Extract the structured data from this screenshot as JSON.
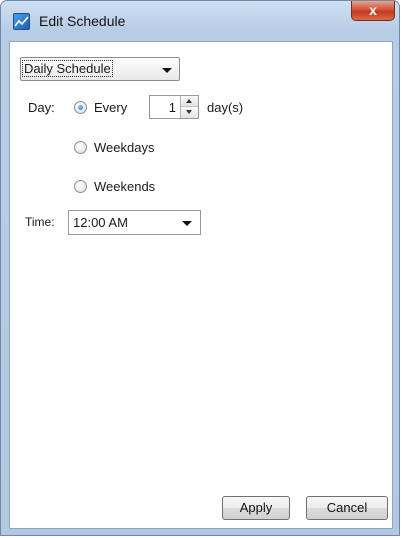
{
  "window": {
    "title": "Edit Schedule",
    "close_label": "x"
  },
  "schedule_type": {
    "selected": "Daily Schedule"
  },
  "day": {
    "label": "Day:",
    "options": [
      {
        "label": "Every",
        "selected": true
      },
      {
        "label": "Weekdays",
        "selected": false
      },
      {
        "label": "Weekends",
        "selected": false
      }
    ],
    "interval_value": "1",
    "interval_unit": "day(s)"
  },
  "time": {
    "label": "Time:",
    "selected": "12:00 AM"
  },
  "buttons": {
    "apply": "Apply",
    "cancel": "Cancel"
  },
  "colors": {
    "accent": "#1d6fc4",
    "titlebar": "#b7cde6",
    "close": "#c23b20"
  }
}
